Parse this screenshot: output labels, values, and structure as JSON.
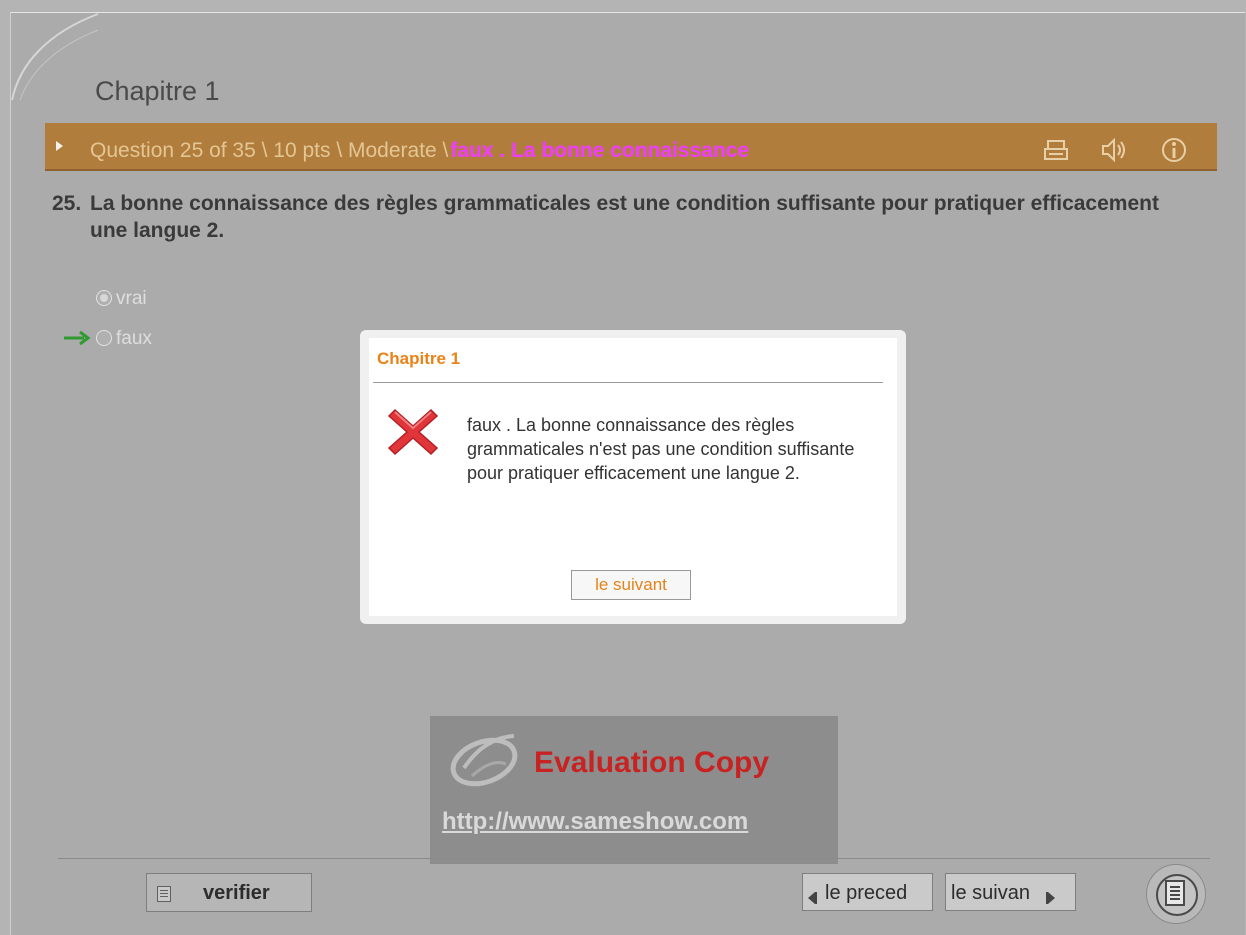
{
  "chapter_title": "Chapitre 1",
  "question_bar": {
    "info": "Question 25 of 35 \\ 10 pts \\ Moderate \\",
    "feedback": "faux . La bonne connaissance",
    "icons": [
      "print-icon",
      "sound-icon",
      "info-icon"
    ]
  },
  "question": {
    "number": "25.",
    "text": "La bonne connaissance des règles grammaticales est une condition suffisante pour pratiquer efficacement une langue 2."
  },
  "options": [
    {
      "label": "vrai",
      "selected": true
    },
    {
      "label": "faux",
      "selected": false,
      "correct": true
    }
  ],
  "modal": {
    "title": "Chapitre 1",
    "message": "faux . La bonne connaissance des règles grammaticales n'est pas une condition suffisante pour pratiquer efficacement une langue 2.",
    "button": "le suivant"
  },
  "watermark": {
    "title": "Evaluation Copy",
    "url": "http://www.sameshow.com"
  },
  "footer": {
    "verify": "verifier",
    "prev": "le preced",
    "next": "le suivan"
  },
  "colors": {
    "question_bar": "#b17d3c",
    "feedback_text": "#f03cff",
    "modal_title": "#e98318",
    "error_icon": "#e0363a",
    "arrow": "#2f9a2f"
  }
}
